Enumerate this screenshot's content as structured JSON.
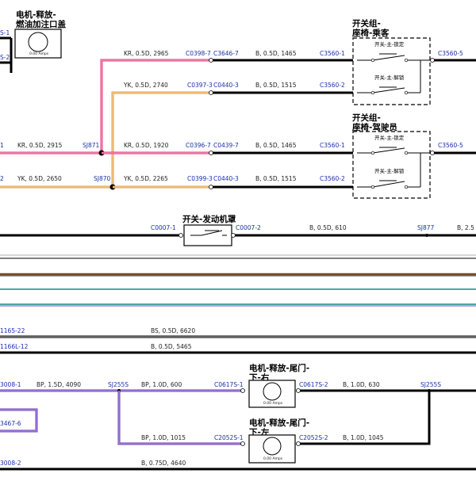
{
  "colors": {
    "pink": "#ea3b7d",
    "orange": "#e0a04b",
    "purple": "#6d3fb5",
    "black": "#000000",
    "connector": "#1a2fa8"
  },
  "components": {
    "fuel_door_motor": {
      "title_line1": "电机-释放-",
      "title_line2": "燃油加注口盖",
      "inner": "0.00 Amps"
    },
    "switch_passenger": {
      "title_line1": "开关组-",
      "title_line2": "座椅-乘客",
      "lock_label": "开关-主-锁定",
      "unlock_label": "开关-主-解锁"
    },
    "switch_driver": {
      "title_line1": "开关组-",
      "title_line2": "座椅-驾驶员",
      "lock_label": "开关-主-锁定",
      "unlock_label": "开关-主-解锁"
    },
    "engine_switch": {
      "title": "开关-发动机罩"
    },
    "tailgate_right": {
      "title_line1": "电机-释放-尾门-",
      "title_line2": "下-右",
      "inner": "0.00 Amps"
    },
    "tailgate_left": {
      "title_line1": "电机-释放-尾门-",
      "title_line2": "下-左",
      "inner": "0.00 Amps"
    }
  },
  "labels": {
    "edge_s1": "S-1",
    "edge_s2": "S-2",
    "edge_1": "1",
    "edge_2": "2",
    "kr_2965": "KR, 0.5D, 2965",
    "yk_2740": "YK, 0.5D, 2740",
    "kr_2915": "KR, 0.5D, 2915",
    "yk_2650": "YK, 0.5D, 2650",
    "kr_1920": "KR, 0.5D, 1920",
    "yk_2265": "YK, 0.5D, 2265",
    "b_1465_top": "B, 0.5D, 1465",
    "b_1515_top": "B, 0.5D, 1515",
    "b_1465_mid": "B, 0.5D, 1465",
    "b_1515_mid": "B, 0.5D, 1515",
    "sj871": "SJ871",
    "sj870": "SJ870",
    "c0398_7": "C0398-7",
    "c3646_7": "C3646-7",
    "c0397_3": "C0397-3",
    "c0440_3_top": "C0440-3",
    "c0396_7": "C0396-7",
    "c0439_7": "C0439-7",
    "c0399_3": "C0399-3",
    "c0440_3_mid": "C0440-3",
    "c3560_1_top": "C3560-1",
    "c3560_2_top": "C3560-2",
    "c3560_5_top": "C3560-5",
    "c3560_1_mid": "C3560-1",
    "c3560_2_mid": "C3560-2",
    "c3560_5_mid": "C3560-5",
    "c0007_1": "C0007-1",
    "c0007_2": "C0007-2",
    "b_610": "B, 0.5D, 610",
    "sj877": "SJ877",
    "b_25": "B, 2.5",
    "c1165_22": "1165-22",
    "bs_6620": "BS, 0.5D, 6620",
    "c1166l_12": "1166L-12",
    "b_5465": "B, 0.5D, 5465",
    "c3008_1": "3008-1",
    "bp_4090": "BP, 1.5D, 4090",
    "sj255s_left": "SJ255S",
    "bp_600": "BP, 1.0D, 600",
    "c0617s_1": "C0617S-1",
    "c0617s_2": "C0617S-2",
    "b_630": "B, 1.0D, 630",
    "sj255s_right": "SJ255S",
    "c3467_6": "3467-6",
    "bp_1015": "BP, 1.0D, 1015",
    "c2052s_1": "C2052S-1",
    "c2052s_2": "C2052S-2",
    "b_1045": "B, 1.0D, 1045",
    "c3008_2": "3008-2",
    "b_4640": "B, 0.75D, 4640"
  }
}
